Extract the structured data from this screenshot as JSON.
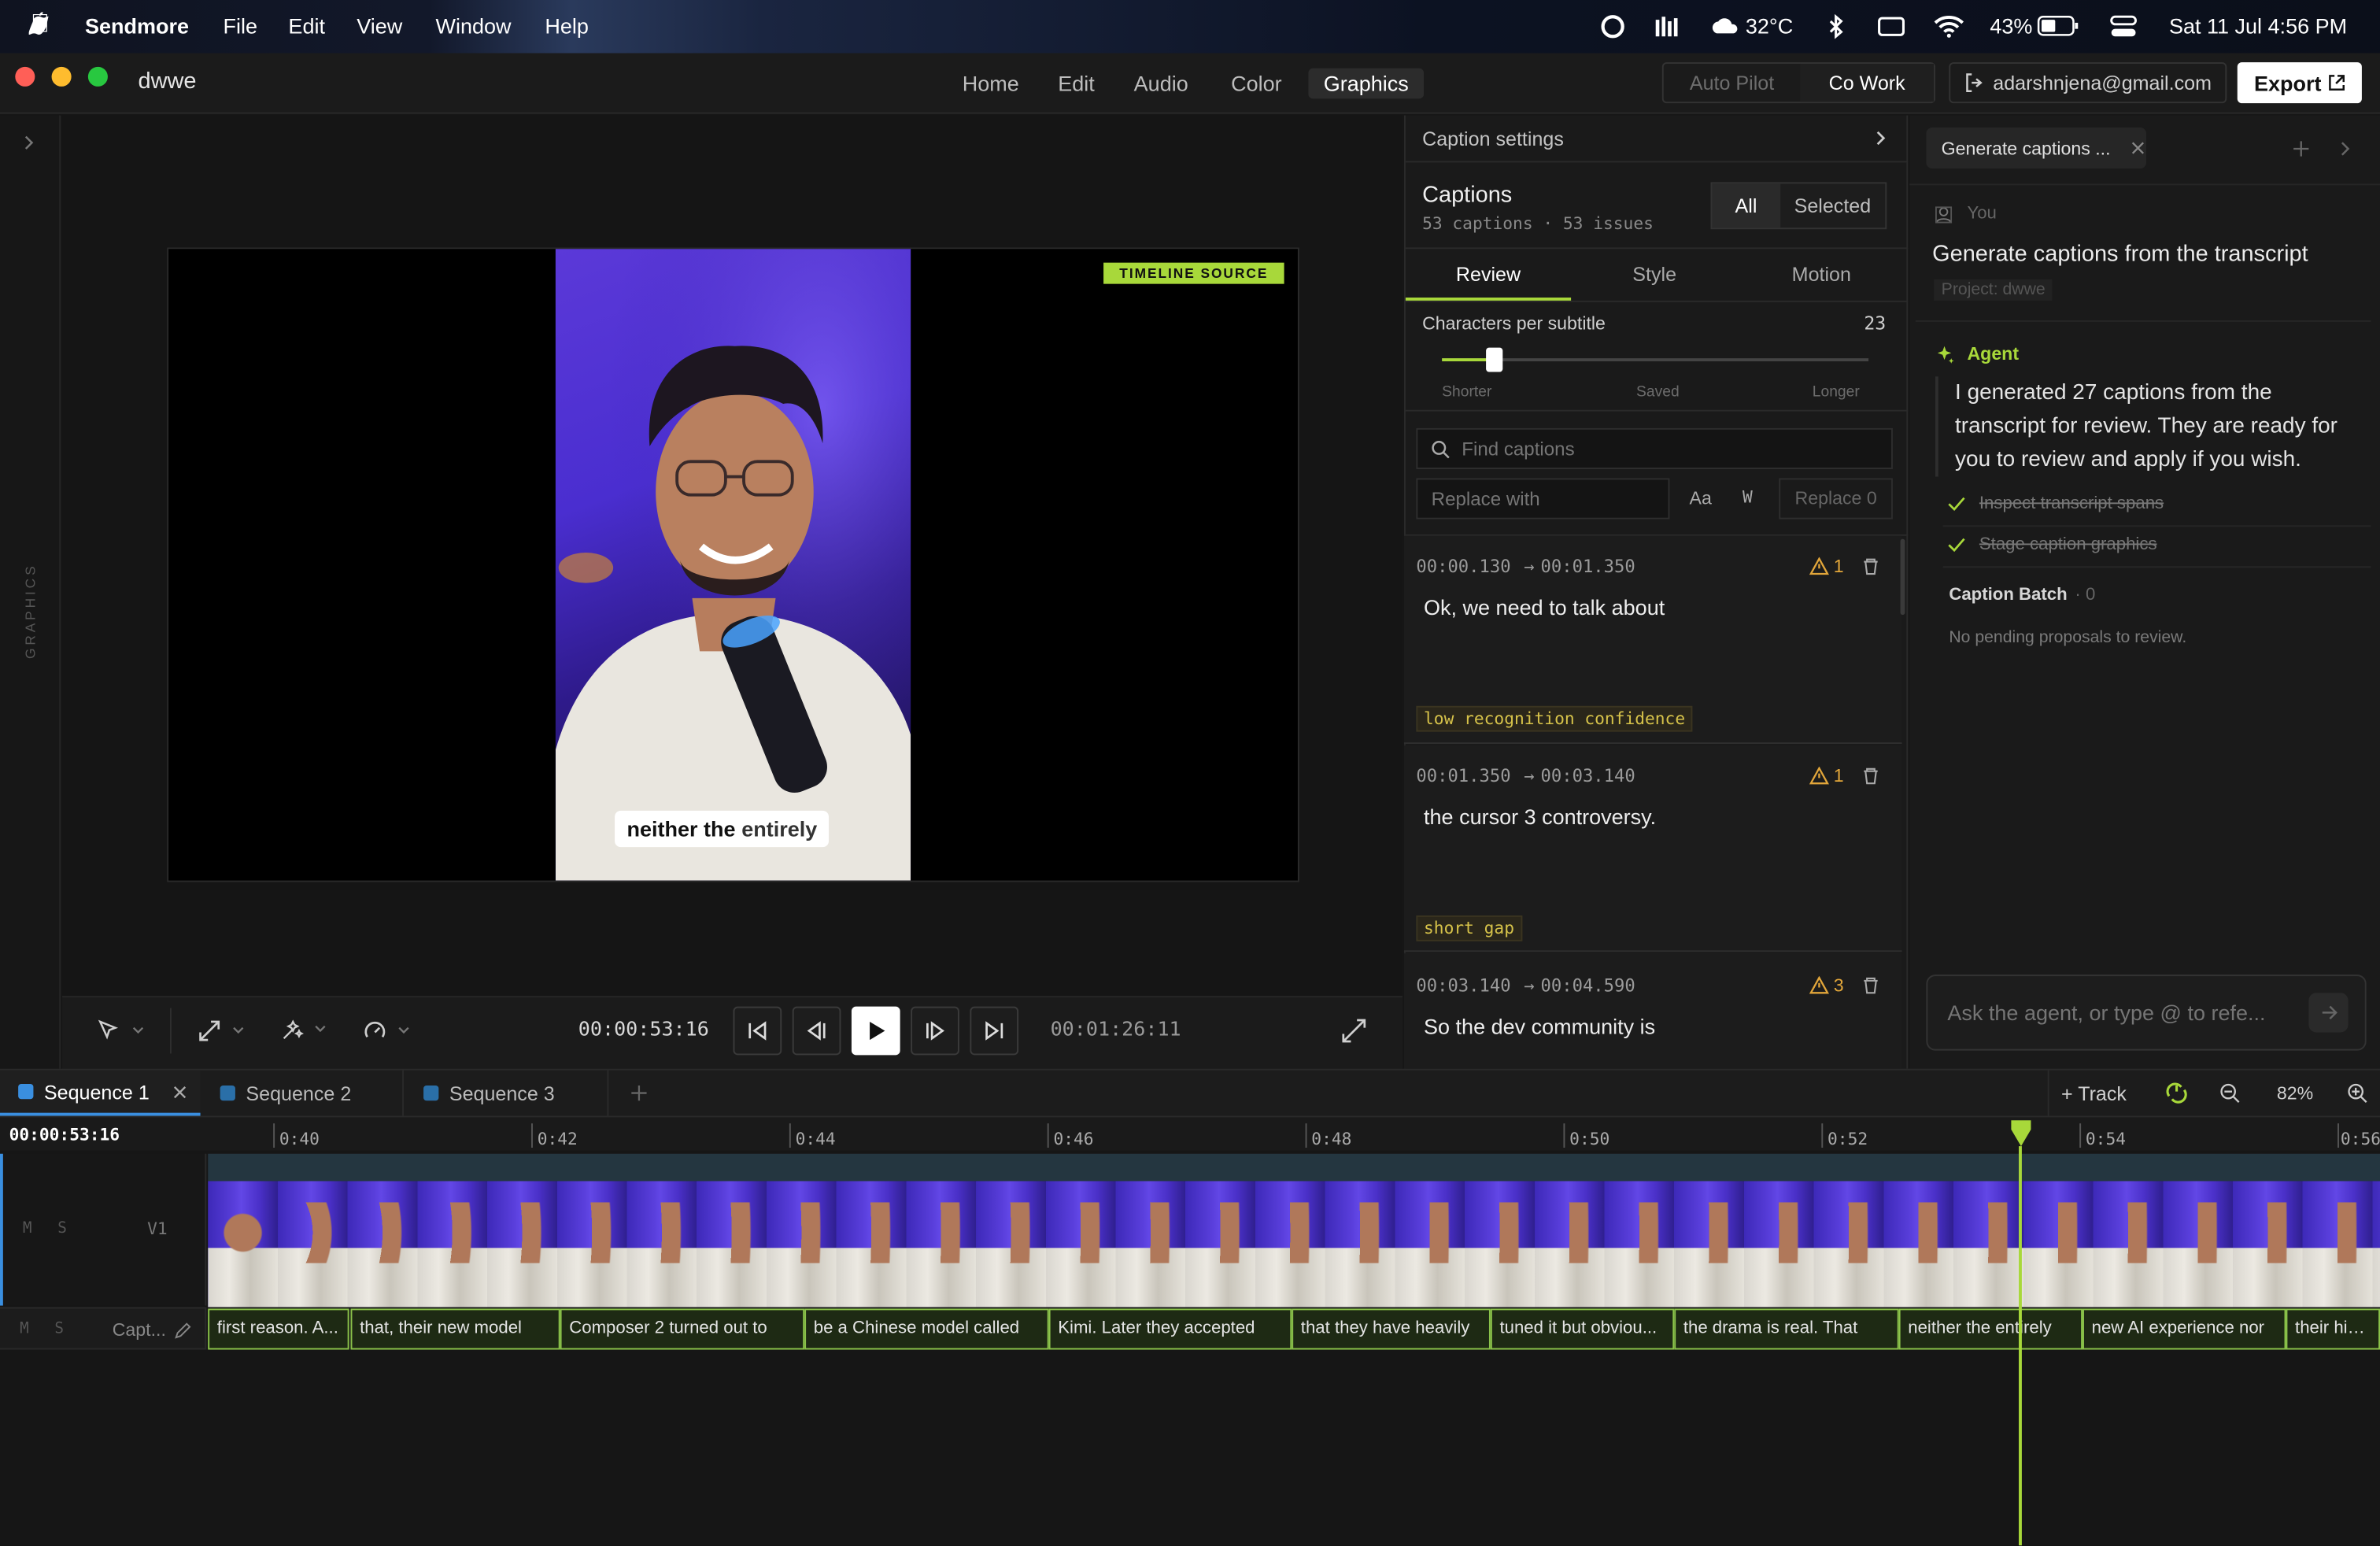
{
  "menubar": {
    "app_name": "Sendmore",
    "menus": [
      "File",
      "Edit",
      "View",
      "Window",
      "Help"
    ],
    "temperature": "32°C",
    "battery": "43%",
    "datetime": "Sat 11 Jul  4:56 PM"
  },
  "window": {
    "project_name": "dwwe",
    "nav_tabs": [
      "Home",
      "Edit",
      "Audio",
      "Color",
      "Graphics"
    ],
    "active_tab": "Graphics",
    "mode_autopilot": "Auto Pilot",
    "mode_cowork": "Co Work",
    "account_email": "adarshnjena@gmail.com",
    "export_label": "Export"
  },
  "left_strip": {
    "label": "GRAPHICS"
  },
  "viewer": {
    "badge": "TIMELINE SOURCE",
    "caption_word1": "neither the",
    "caption_word2": "entirely",
    "current_time": "00:00:53:16",
    "duration": "00:01:26:11"
  },
  "caption_panel": {
    "header": "Caption settings",
    "title": "Captions",
    "subtitle": "53 captions · 53 issues",
    "filter_all": "All",
    "filter_selected": "Selected",
    "tabs": [
      "Review",
      "Style",
      "Motion"
    ],
    "cps_label": "Characters per subtitle",
    "cps_value": "23",
    "cps_fraction": 0.12,
    "slider_labels": [
      "Shorter",
      "Saved",
      "Longer"
    ],
    "find_placeholder": "Find captions",
    "replace_placeholder": "Replace with",
    "opt_case": "Aa",
    "opt_word": "W",
    "replace_btn": "Replace 0",
    "cards": [
      {
        "start": "00:00.130",
        "end": "00:01.350",
        "issues": "1",
        "text": "Ok, we need to talk about",
        "tag": "low recognition confidence"
      },
      {
        "start": "00:01.350",
        "end": "00:03.140",
        "issues": "1",
        "text": "the cursor 3 controversy.",
        "tag": "short gap"
      },
      {
        "start": "00:03.140",
        "end": "00:04.590",
        "issues": "3",
        "text": "So the dev community is",
        "tag": ""
      }
    ]
  },
  "agent": {
    "tab_label": "Generate captions ...",
    "you_label": "You",
    "user_msg": "Generate captions from the transcript",
    "project_chip": "Project: dwwe",
    "agent_label": "Agent",
    "agent_msg": "I generated 27 captions from the transcript for review. They are ready for you to review and apply if you wish.",
    "steps": [
      "Inspect transcript spans",
      "Stage caption graphics"
    ],
    "batch_label": "Caption Batch",
    "batch_count": "· 0",
    "pending_msg": "No pending proposals to review.",
    "input_placeholder": "Ask the agent, or type @ to refe..."
  },
  "timeline": {
    "sequences": [
      "Sequence 1",
      "Sequence 2",
      "Sequence 3"
    ],
    "add_track": "+ Track",
    "zoom": "82%",
    "timecode": "00:00:53:16",
    "ticks": [
      "0:40",
      "0:42",
      "0:44",
      "0:46",
      "0:48",
      "0:50",
      "0:52",
      "0:54",
      "0:56"
    ],
    "video_track_label": "V1",
    "caption_track_label": "Capt...",
    "mute": "M",
    "solo": "S",
    "caption_clips": [
      "first reason. A...",
      "that, their new model",
      "Composer 2 turned out to",
      "be a Chinese model called",
      "Kimi. Later they accepted",
      "that they have heavily",
      "tuned it but obviou...",
      "the drama is real. That",
      "neither the entirely",
      "new AI experience nor",
      "their hiding"
    ]
  }
}
